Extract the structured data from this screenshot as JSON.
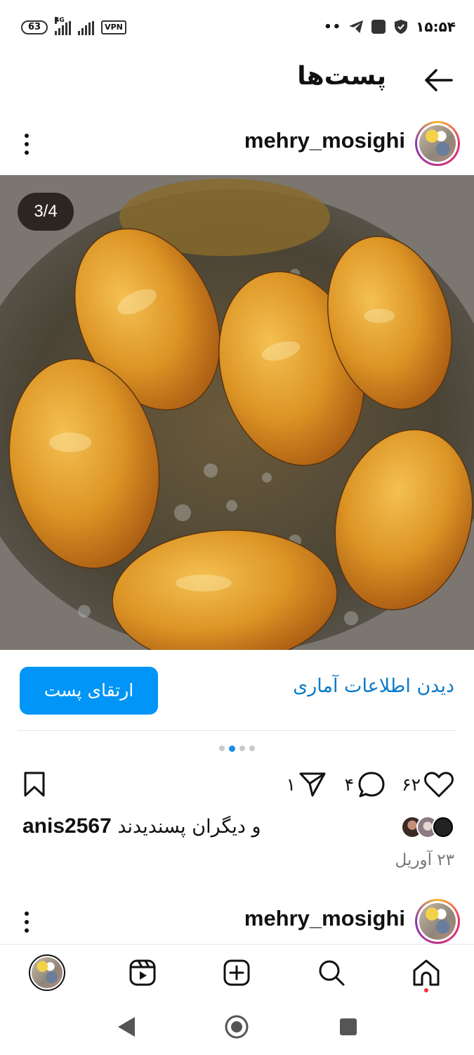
{
  "status_bar": {
    "battery": "63",
    "network": "4G",
    "vpn": "VPN",
    "notif_dots": "••",
    "time": "۱۵:۵۴"
  },
  "header": {
    "title": "پست‌ها"
  },
  "post": {
    "username": "mehry_mosighi",
    "image_counter": "3/4",
    "promote_label": "ارتقای پست",
    "insights_label": "دیدن اطلاعات آماری",
    "carousel": {
      "total": 4,
      "active_index": 1
    },
    "likes": "۶۲",
    "comments": "۴",
    "shares": "۱",
    "liked_by_user": "anis2567",
    "liked_by_suffix": "و دیگران پسندیدند",
    "date": "۲۳ آوریل"
  },
  "next_post": {
    "username": "mehry_mosighi"
  },
  "colors": {
    "accent": "#0095f6",
    "link": "#0a7bc9",
    "notification": "#ff3040"
  },
  "icons": [
    "back-arrow-icon",
    "more-icon",
    "bookmark-icon",
    "heart-icon",
    "comment-icon",
    "share-icon",
    "home-icon",
    "search-icon",
    "create-icon",
    "reels-icon"
  ]
}
